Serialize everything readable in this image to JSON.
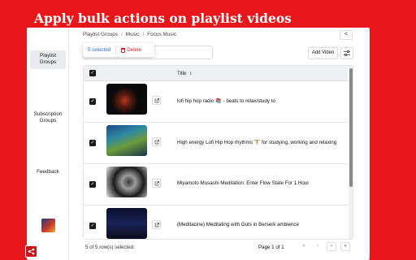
{
  "promo": {
    "title": "Apply bulk actions on playlist videos"
  },
  "sidebar": {
    "items": [
      {
        "label_line1": "Playlist",
        "label_line2": "Groups",
        "active": true
      },
      {
        "label_line1": "Subscription",
        "label_line2": "Groups",
        "active": false
      },
      {
        "label_line1": "Feedback",
        "label_line2": "",
        "active": false
      }
    ]
  },
  "breadcrumb": {
    "items": [
      "Playlist Groups",
      "Music",
      "Focus Music"
    ]
  },
  "toolbar": {
    "collapse_label": "<",
    "filter_value": "",
    "add_video_label": "Add Video",
    "settings_icon": "sliders-icon"
  },
  "selection": {
    "count_label": "5 selected",
    "delete_label": "Delete"
  },
  "table": {
    "columns": {
      "title": "Title",
      "sort_icon": "⇕"
    },
    "rows": [
      {
        "title": "lofi hip hop radio 📚 - beats to relax/study to",
        "checked": true
      },
      {
        "title": "High energy Lofi Hip Hop rhythms 🏋 for studying, working and relaxing",
        "checked": true
      },
      {
        "title": "Miyamoto Musashi Meditation: Enter Flow State For 1 Hour",
        "checked": true
      },
      {
        "title": "(Meditacine) Meditating with Guts in Berserk ambience",
        "checked": true
      }
    ]
  },
  "footer": {
    "selected_text": "5 of 5 row(s) selected.",
    "page_text": "Page 1 of 1",
    "pager": {
      "first": "«",
      "prev": "‹",
      "next": "›",
      "last": "»"
    }
  },
  "colors": {
    "brand_red": "#e8151b",
    "selection_blue": "#2f6fd6",
    "delete_red": "#d32121"
  }
}
